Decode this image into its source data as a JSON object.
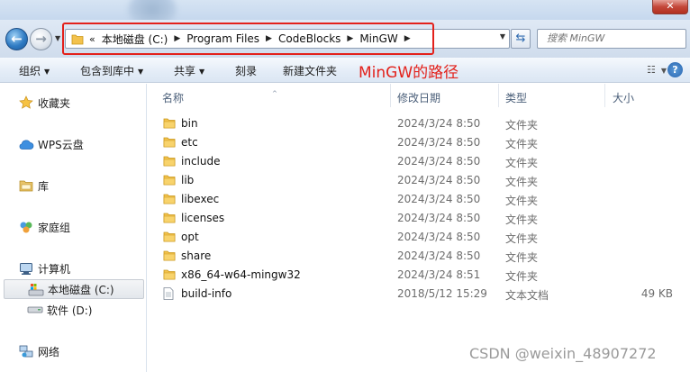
{
  "address_bar": {
    "overflow_marker": "«",
    "crumbs": [
      "本地磁盘 (C:)",
      "Program Files",
      "CodeBlocks",
      "MinGW"
    ]
  },
  "search": {
    "placeholder": "搜索 MinGW"
  },
  "toolbar": {
    "organize": "组织",
    "include_in_library": "包含到库中",
    "share": "共享",
    "burn": "刻录",
    "new_folder": "新建文件夹"
  },
  "annotation": {
    "text": "MinGW的路径",
    "color": "#e3211b"
  },
  "nav": {
    "favorites": "收藏夹",
    "wps_cloud": "WPS云盘",
    "libraries": "库",
    "homegroup": "家庭组",
    "computer": "计算机",
    "local_disk_c": "本地磁盘 (C:)",
    "software_d": "软件 (D:)",
    "network": "网络"
  },
  "columns": {
    "name": "名称",
    "date": "修改日期",
    "type": "类型",
    "size": "大小"
  },
  "files": [
    {
      "name": "bin",
      "date": "2024/3/24 8:50",
      "type": "文件夹",
      "size": "",
      "icon": "folder-icon"
    },
    {
      "name": "etc",
      "date": "2024/3/24 8:50",
      "type": "文件夹",
      "size": "",
      "icon": "folder-icon"
    },
    {
      "name": "include",
      "date": "2024/3/24 8:50",
      "type": "文件夹",
      "size": "",
      "icon": "folder-icon"
    },
    {
      "name": "lib",
      "date": "2024/3/24 8:50",
      "type": "文件夹",
      "size": "",
      "icon": "folder-icon"
    },
    {
      "name": "libexec",
      "date": "2024/3/24 8:50",
      "type": "文件夹",
      "size": "",
      "icon": "folder-icon"
    },
    {
      "name": "licenses",
      "date": "2024/3/24 8:50",
      "type": "文件夹",
      "size": "",
      "icon": "folder-icon"
    },
    {
      "name": "opt",
      "date": "2024/3/24 8:50",
      "type": "文件夹",
      "size": "",
      "icon": "folder-icon"
    },
    {
      "name": "share",
      "date": "2024/3/24 8:50",
      "type": "文件夹",
      "size": "",
      "icon": "folder-icon"
    },
    {
      "name": "x86_64-w64-mingw32",
      "date": "2024/3/24 8:51",
      "type": "文件夹",
      "size": "",
      "icon": "folder-icon"
    },
    {
      "name": "build-info",
      "date": "2018/5/12 15:29",
      "type": "文本文档",
      "size": "49 KB",
      "icon": "text-file-icon"
    }
  ],
  "watermark": "CSDN @weixin_48907272",
  "colors": {
    "accent": "#2e6ab0",
    "annotation": "#e3211b",
    "folder": "#f3c24d"
  }
}
